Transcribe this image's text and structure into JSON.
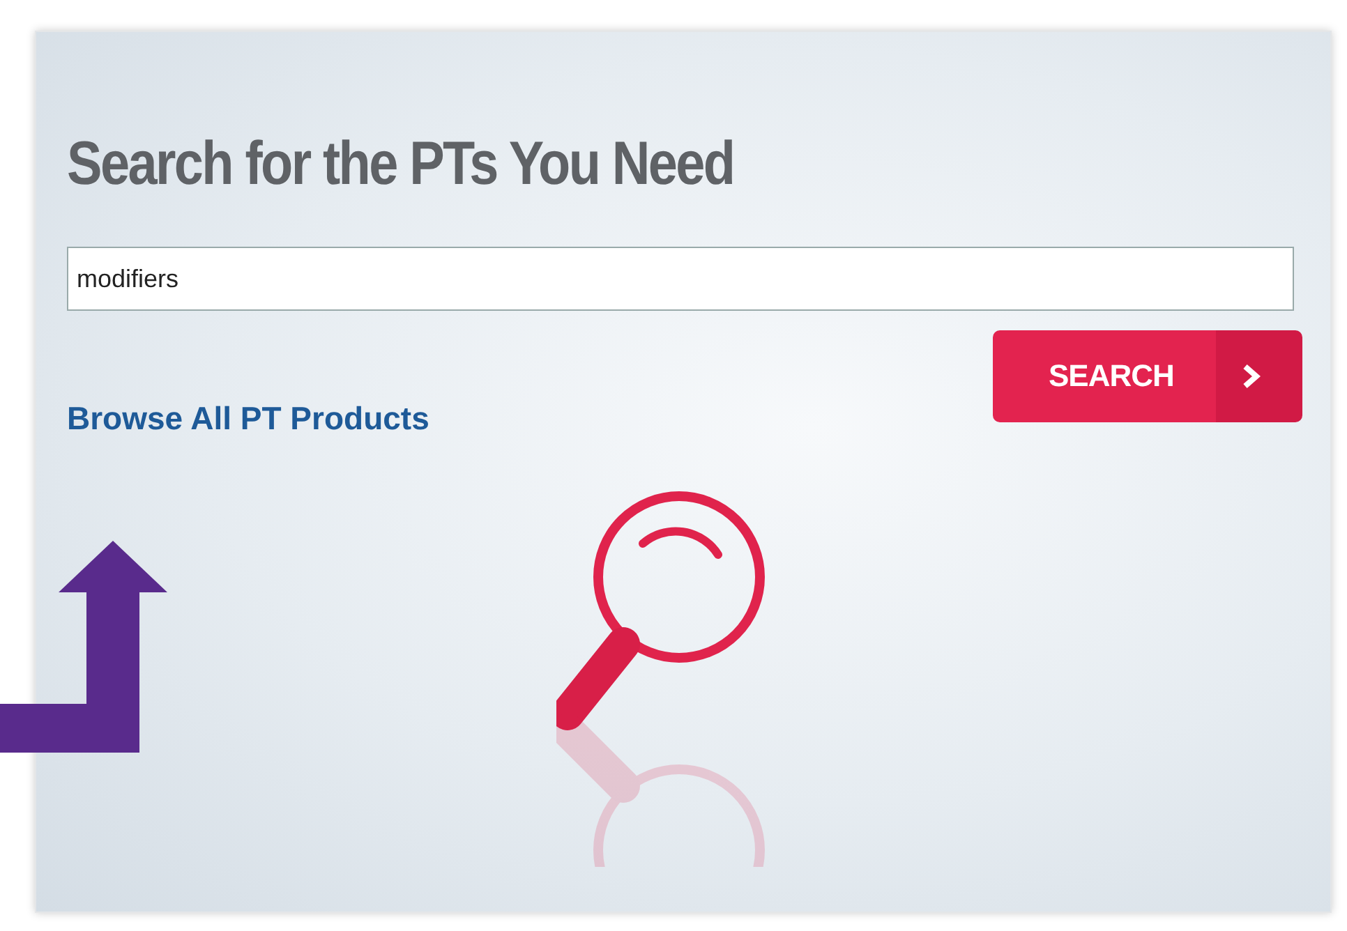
{
  "panel": {
    "title": "Search for the PTs You Need",
    "search_field": {
      "value": "modifiers"
    },
    "search_button": {
      "label": "SEARCH"
    },
    "browse_link": "Browse All PT Products"
  }
}
